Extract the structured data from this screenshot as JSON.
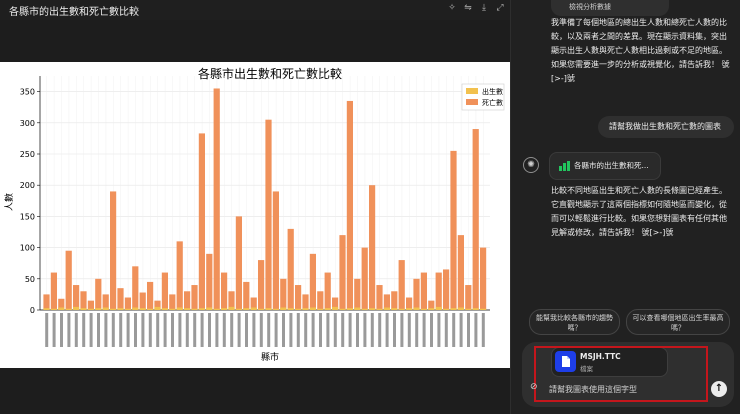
{
  "window": {
    "title": "各縣市的出生數和死亡數比較"
  },
  "toolbar": {
    "icons": [
      "wand-icon",
      "sliders-icon",
      "download-icon",
      "expand-icon"
    ]
  },
  "chart_data": {
    "type": "bar",
    "title": "各縣市出生數和死亡數比較",
    "xlabel": "縣市",
    "ylabel": "人數",
    "ylim": [
      0,
      375
    ],
    "yticks": [
      0,
      50,
      100,
      150,
      200,
      250,
      300,
      350
    ],
    "grid": true,
    "legend_position": "top-right",
    "series": [
      {
        "name": "出生數",
        "color": "#f2c14e",
        "values": [
          3,
          2,
          4,
          2,
          5,
          3,
          2,
          3,
          4,
          2,
          3,
          2,
          4,
          3,
          2,
          5,
          3,
          2,
          4,
          3,
          2,
          3,
          4,
          2,
          3,
          5,
          2,
          3,
          4,
          2,
          3,
          2,
          4,
          3,
          2,
          3,
          4,
          2,
          3,
          5,
          2,
          3,
          4,
          2,
          3,
          2,
          4,
          3,
          2,
          3,
          4,
          2,
          3,
          5,
          2,
          3,
          4,
          2,
          3,
          2
        ]
      },
      {
        "name": "死亡數",
        "color": "#f0915a",
        "values": [
          25,
          60,
          18,
          95,
          40,
          30,
          15,
          50,
          25,
          190,
          35,
          20,
          70,
          28,
          45,
          15,
          60,
          25,
          110,
          30,
          40,
          283,
          90,
          355,
          60,
          30,
          150,
          45,
          20,
          80,
          305,
          190,
          50,
          130,
          40,
          25,
          90,
          30,
          60,
          20,
          120,
          335,
          50,
          100,
          200,
          40,
          25,
          30,
          80,
          20,
          50,
          60,
          15,
          60,
          65,
          255,
          120,
          40,
          290,
          100
        ]
      }
    ]
  },
  "right": {
    "top_pill": "檢視分析數據",
    "intro_text": "我準備了每個地區的總出生人數和總死亡人數的比較，以及兩者之間的差異。現在顯示資料集，突出顯示出生人數與死亡人數相比過剩或不足的地區。如果您需要進一步的分析或視覺化，請告訴我！ 號[>-]號",
    "user_msg": "請幫我做出生數和死亡數的圖表",
    "chart_chip": "各縣市的出生數和死...",
    "reply_text": "比較不同地區出生和死亡人數的長條圖已經產生。它直觀地顯示了這兩個指標如何隨地區而變化，從而可以輕鬆進行比較。如果您想對圖表有任何其他見解或修改，請告訴我！ 號[>-]號",
    "suggestion1": "能幫我比較各縣市的趨勢嗎？",
    "suggestion2": "可以查看哪個地區出生率最高嗎？",
    "file_name": "MSJH.TTC",
    "file_type": "檔案",
    "input_text": "請幫我圖表使用這個字型"
  }
}
